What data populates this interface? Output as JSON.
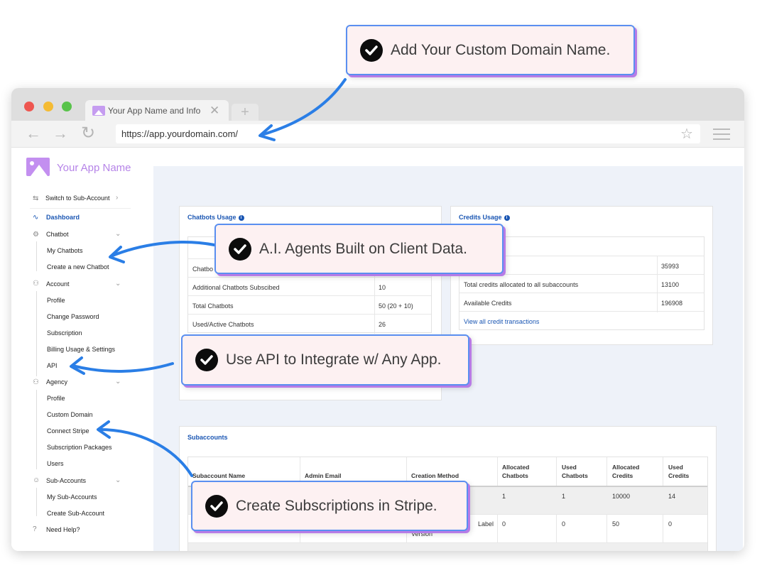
{
  "browser": {
    "tab_title": "Your App Name and Info",
    "tab_close": "✕",
    "new_tab": "+",
    "url": "https://app.yourdomain.com/",
    "back": "←",
    "forward": "→",
    "reload": "↻",
    "star": "☆"
  },
  "sidebar": {
    "app_name": "Your App Name",
    "switch_label": "Switch to Sub-Account",
    "dashboard": "Dashboard",
    "chatbot": "Chatbot",
    "my_chatbots": "My Chatbots",
    "create_chatbot": "Create a new Chatbot",
    "account": "Account",
    "profile": "Profile",
    "change_password": "Change Password",
    "subscription": "Subscription",
    "billing": "Billing Usage & Settings",
    "api": "API",
    "agency": "Agency",
    "agency_profile": "Profile",
    "custom_domain": "Custom Domain",
    "connect_stripe": "Connect Stripe",
    "subscription_packages": "Subscription Packages",
    "users": "Users",
    "sub_accounts": "Sub-Accounts",
    "my_sub_accounts": "My Sub-Accounts",
    "create_sub_account": "Create Sub-Account",
    "need_help": "Need Help?"
  },
  "chatbots_usage": {
    "title": "Chatbots Usage",
    "rows": [
      {
        "label": "Chatbo",
        "value": ""
      },
      {
        "label": "Additional Chatbots Subscibed",
        "value": "10"
      },
      {
        "label": "Total Chatbots",
        "value": "50 (20 + 10)"
      },
      {
        "label": "Used/Active Chatbots",
        "value": "26"
      }
    ]
  },
  "credits_usage": {
    "title": "Credits Usage",
    "rows": [
      {
        "label": "",
        "value": "35993"
      },
      {
        "label": "Total credits allocated to all subaccounts",
        "value": "13100"
      },
      {
        "label": "Available Credits",
        "value": "196908"
      }
    ],
    "link": "View all credit transactions"
  },
  "subaccounts": {
    "title": "Subaccounts",
    "headers": {
      "name": "Subaccount Name",
      "email": "Admin Email",
      "method": "Creation Method",
      "alloc_chatbots": "Allocated Chatbots",
      "used_chatbots": "Used Chatbots",
      "alloc_credits": "Allocated Credits",
      "used_credits": "Used Credits"
    },
    "rows": [
      {
        "alloc_chatbots": "1",
        "used_chatbots": "1",
        "alloc_credits": "10000",
        "used_credits": "14"
      },
      {
        "method": "Label",
        "method2": "Version",
        "alloc_chatbots": "0",
        "used_chatbots": "0",
        "alloc_credits": "50",
        "used_credits": "0"
      }
    ]
  },
  "callouts": {
    "domain": "Add Your Custom Domain Name.",
    "agents": "A.I. Agents Built on Client Data.",
    "api": "Use API to Integrate w/ Any App.",
    "stripe": "Create Subscriptions in Stripe."
  },
  "colors": {
    "accent_blue": "#1a56b3",
    "callout_border": "#5a8ff0",
    "callout_shadow": "#b77be6",
    "arrow": "#2a7ee6"
  }
}
